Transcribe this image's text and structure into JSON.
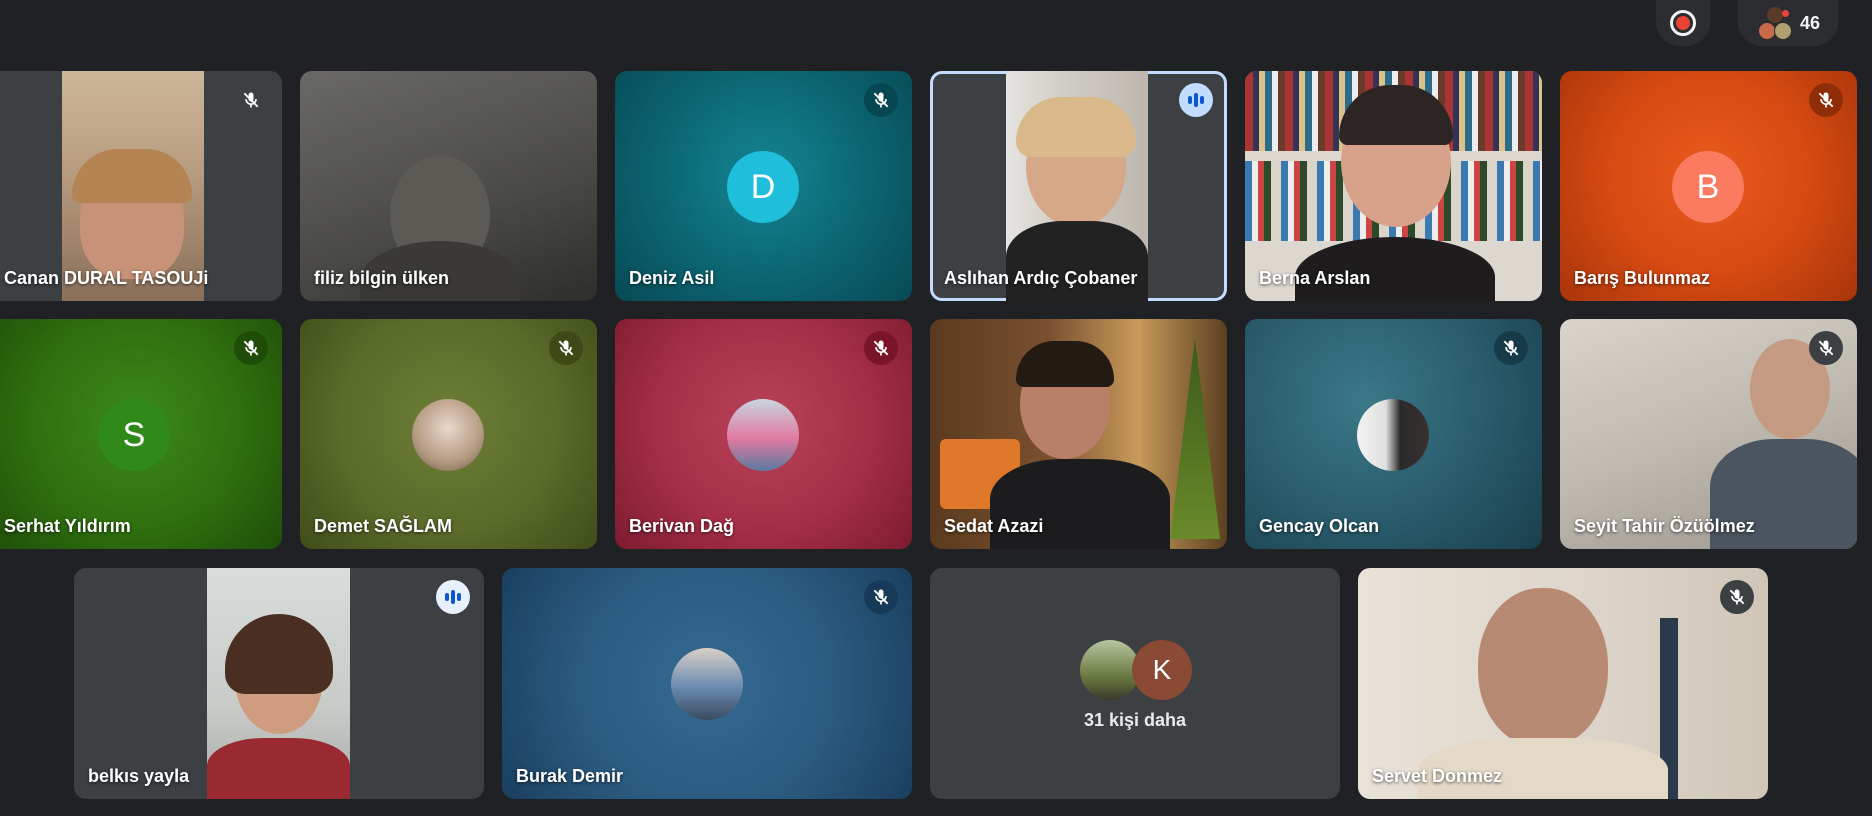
{
  "topbar": {
    "participant_count": "46",
    "record_icon": "record-icon",
    "people_icon": "participants-avatars"
  },
  "participants": {
    "canan": "Canan DURAL TASOUJi",
    "filiz": "filiz bilgin ülken",
    "deniz": "Deniz Asil",
    "aslihan": "Aslıhan Ardıç Çobaner",
    "berna": "Berna Arslan",
    "baris": "Barış Bulunmaz",
    "serhat": "Serhat Yıldırım",
    "demet": "Demet SAĞLAM",
    "berivan": "Berivan Dağ",
    "sedat": "Sedat Azazi",
    "gencay": "Gencay Olcan",
    "seyit": "Seyit Tahir Özüölmez",
    "belkis": "belkıs yayla",
    "burak": "Burak Demir",
    "servet": "Servet Donmez"
  },
  "avatars": {
    "deniz": "D",
    "baris": "B",
    "serhat": "S",
    "more": "K"
  },
  "more": {
    "label": "31 kişi daha"
  },
  "colors": {
    "background": "#202124",
    "speaking_border": "#c2dcff",
    "teal": "#0b6470",
    "orange": "#d74a12",
    "green": "#2f6f0f",
    "olive": "#5a6b2a",
    "crimson": "#a42e45",
    "slate": "#285a6a",
    "blue": "#2a5a80"
  }
}
